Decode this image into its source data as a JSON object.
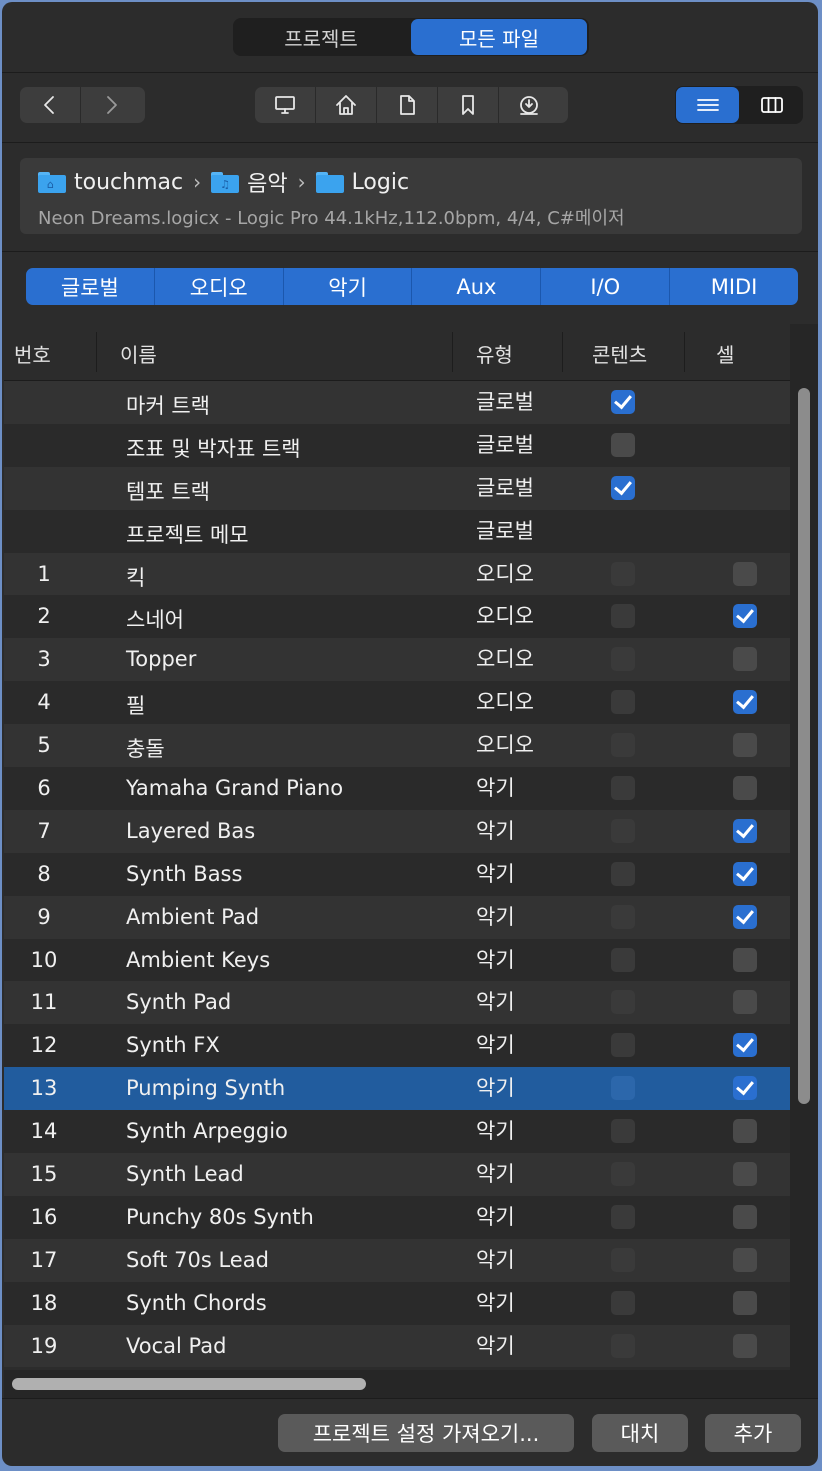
{
  "top_tabs": [
    {
      "label": "프로젝트",
      "active": false
    },
    {
      "label": "모든 파일",
      "active": true
    }
  ],
  "toolbar": {
    "nav_icons": [
      "back-icon",
      "forward-icon"
    ],
    "location_icons": [
      "computer-icon",
      "home-icon",
      "document-icon",
      "bookmark-icon",
      "download-icon"
    ],
    "view_icons": [
      "list-view-icon",
      "column-view-icon"
    ]
  },
  "breadcrumb": {
    "items": [
      {
        "label": "touchmac",
        "icon": "home-folder-icon"
      },
      {
        "label": "음악",
        "icon": "music-folder-icon"
      },
      {
        "label": "Logic",
        "icon": "folder-icon"
      }
    ],
    "info": "Neon Dreams.logicx - Logic Pro 44.1kHz,112.0bpm, 4/4, C#메이저"
  },
  "categories": [
    "글로벌",
    "오디오",
    "악기",
    "Aux",
    "I/O",
    "MIDI"
  ],
  "table": {
    "headers": {
      "num": "번호",
      "name": "이름",
      "type": "유형",
      "content": "콘텐츠",
      "cell": "셀"
    },
    "rows": [
      {
        "num": "",
        "name": "마커 트랙",
        "type": "글로벌",
        "content": "on",
        "cell": "none"
      },
      {
        "num": "",
        "name": "조표 및 박자표 트랙",
        "type": "글로벌",
        "content": "off",
        "cell": "none"
      },
      {
        "num": "",
        "name": "템포 트랙",
        "type": "글로벌",
        "content": "on",
        "cell": "none"
      },
      {
        "num": "",
        "name": "프로젝트 메모",
        "type": "글로벌",
        "content": "none",
        "cell": "none"
      },
      {
        "num": "1",
        "name": "킥",
        "type": "오디오",
        "content": "dis",
        "cell": "off"
      },
      {
        "num": "2",
        "name": "스네어",
        "type": "오디오",
        "content": "dis",
        "cell": "on"
      },
      {
        "num": "3",
        "name": "Topper",
        "type": "오디오",
        "content": "dis",
        "cell": "off"
      },
      {
        "num": "4",
        "name": "필",
        "type": "오디오",
        "content": "dis",
        "cell": "on"
      },
      {
        "num": "5",
        "name": "충돌",
        "type": "오디오",
        "content": "dis",
        "cell": "off"
      },
      {
        "num": "6",
        "name": "Yamaha Grand Piano",
        "type": "악기",
        "content": "dis",
        "cell": "off"
      },
      {
        "num": "7",
        "name": "Layered Bas",
        "type": "악기",
        "content": "dis",
        "cell": "on"
      },
      {
        "num": "8",
        "name": "Synth Bass",
        "type": "악기",
        "content": "dis",
        "cell": "on"
      },
      {
        "num": "9",
        "name": "Ambient Pad",
        "type": "악기",
        "content": "dis",
        "cell": "on"
      },
      {
        "num": "10",
        "name": "Ambient Keys",
        "type": "악기",
        "content": "dis",
        "cell": "off"
      },
      {
        "num": "11",
        "name": "Synth Pad",
        "type": "악기",
        "content": "dis",
        "cell": "off"
      },
      {
        "num": "12",
        "name": "Synth FX",
        "type": "악기",
        "content": "dis",
        "cell": "on"
      },
      {
        "num": "13",
        "name": "Pumping Synth",
        "type": "악기",
        "content": "dis",
        "cell": "on",
        "selected": true
      },
      {
        "num": "14",
        "name": "Synth Arpeggio",
        "type": "악기",
        "content": "dis",
        "cell": "off"
      },
      {
        "num": "15",
        "name": "Synth Lead",
        "type": "악기",
        "content": "dis",
        "cell": "off"
      },
      {
        "num": "16",
        "name": "Punchy 80s Synth",
        "type": "악기",
        "content": "dis",
        "cell": "off"
      },
      {
        "num": "17",
        "name": "Soft 70s Lead",
        "type": "악기",
        "content": "dis",
        "cell": "off"
      },
      {
        "num": "18",
        "name": "Synth Chords",
        "type": "악기",
        "content": "dis",
        "cell": "off"
      },
      {
        "num": "19",
        "name": "Vocal Pad",
        "type": "악기",
        "content": "dis",
        "cell": "off"
      }
    ]
  },
  "buttons": {
    "import": "프로젝트 설정 가져오기...",
    "replace": "대치",
    "add": "추가"
  },
  "colors": {
    "accent": "#2a6fd0",
    "selection": "#215c9e",
    "background": "#2c2c2c"
  }
}
